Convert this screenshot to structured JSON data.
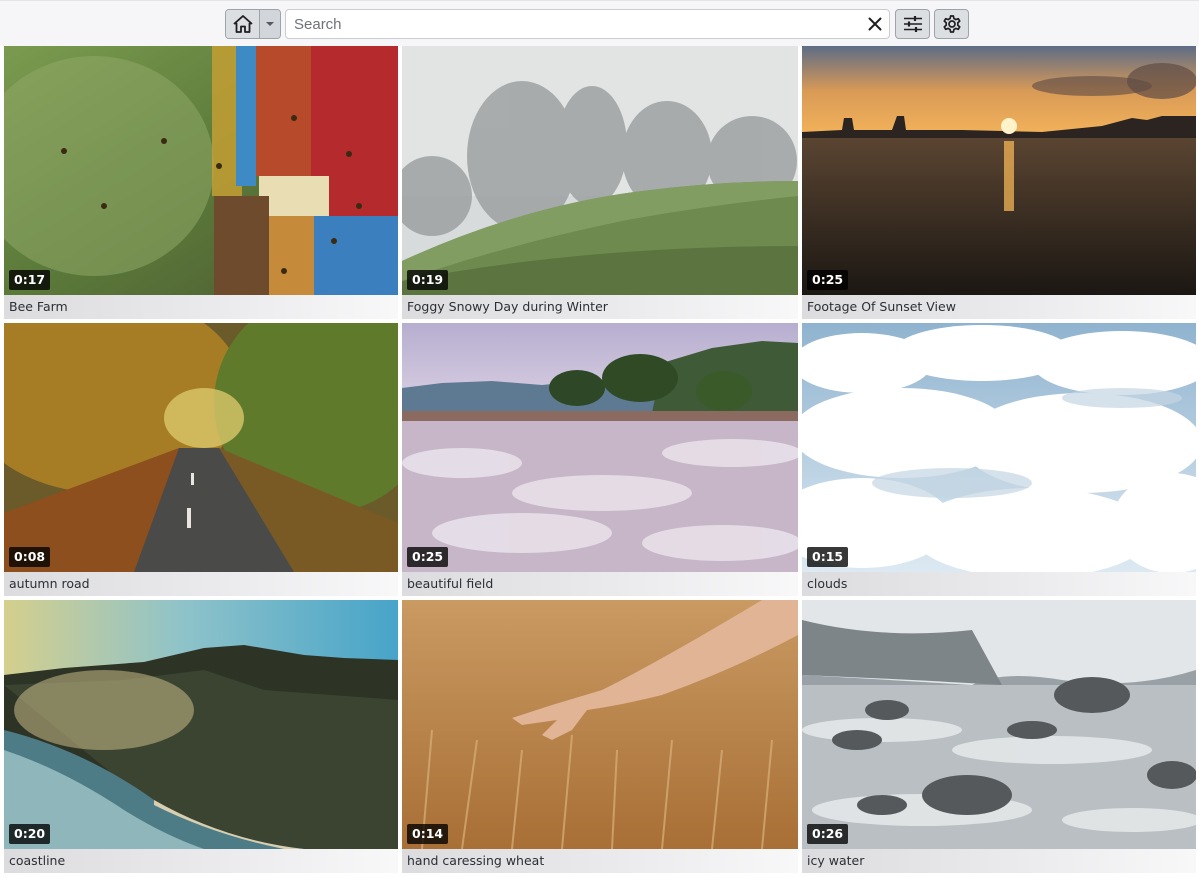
{
  "toolbar": {
    "home_icon": "home-icon",
    "dropdown_icon": "caret-down-icon",
    "search_placeholder": "Search",
    "clear_icon": "close-icon",
    "filter_icon": "sliders-icon",
    "settings_icon": "gear-icon"
  },
  "videos": [
    {
      "title": "Bee Farm",
      "duration": "0:17"
    },
    {
      "title": "Foggy Snowy Day during Winter",
      "duration": "0:19"
    },
    {
      "title": "Footage Of Sunset View",
      "duration": "0:25"
    },
    {
      "title": "autumn road",
      "duration": "0:08"
    },
    {
      "title": "beautiful field",
      "duration": "0:25"
    },
    {
      "title": "clouds",
      "duration": "0:15"
    },
    {
      "title": "coastline",
      "duration": "0:20"
    },
    {
      "title": "hand caressing wheat",
      "duration": "0:14"
    },
    {
      "title": "icy water",
      "duration": "0:26"
    }
  ],
  "colors": {
    "toolbar_bg": "#f6f6f8",
    "button_bg": "#dcdfe2",
    "caption_bg": "#dcdcdf",
    "badge_bg": "#000000"
  }
}
